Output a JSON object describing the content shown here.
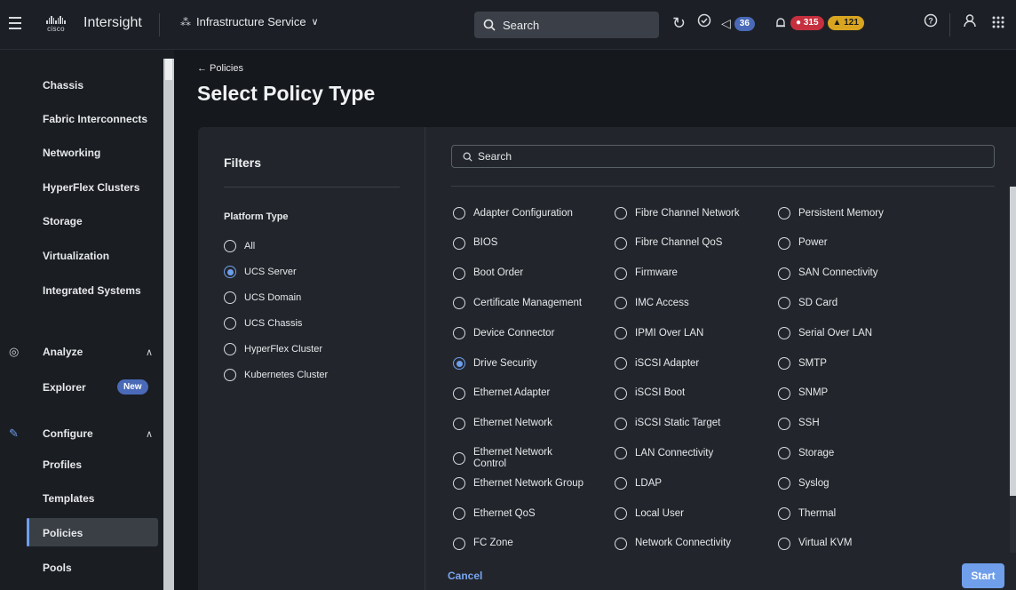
{
  "topbar": {
    "brand_word": "cisco",
    "app_name": "Intersight",
    "service": "Infrastructure Service",
    "search_placeholder": "Search",
    "announcements_count": "36",
    "alarms_critical": "315",
    "alarms_warning": "121"
  },
  "sidebar": {
    "items_top": [
      "Chassis",
      "Fabric Interconnects",
      "Networking",
      "HyperFlex Clusters",
      "Storage",
      "Virtualization",
      "Integrated Systems"
    ],
    "analyze": {
      "label": "Analyze",
      "items": [
        "Explorer"
      ],
      "explorer_badge": "New"
    },
    "configure": {
      "label": "Configure",
      "items": [
        "Profiles",
        "Templates",
        "Policies",
        "Pools"
      ]
    },
    "active_item": "Policies"
  },
  "main": {
    "breadcrumb": "← Policies",
    "title": "Select Policy Type",
    "filters": {
      "title": "Filters",
      "platform_type_label": "Platform Type",
      "options": [
        "All",
        "UCS Server",
        "UCS Domain",
        "UCS Chassis",
        "HyperFlex Cluster",
        "Kubernetes Cluster"
      ],
      "selected": "UCS Server"
    },
    "search_placeholder": "Search",
    "policies_col1": [
      "Adapter Configuration",
      "BIOS",
      "Boot Order",
      "Certificate Management",
      "Device Connector",
      "Drive Security",
      "Ethernet Adapter",
      "Ethernet Network",
      "Ethernet Network Control",
      "Ethernet Network Group",
      "Ethernet QoS",
      "FC Zone"
    ],
    "policies_col2": [
      "Fibre Channel Network",
      "Fibre Channel QoS",
      "Firmware",
      "IMC Access",
      "IPMI Over LAN",
      "iSCSI Adapter",
      "iSCSI Boot",
      "iSCSI Static Target",
      "LAN Connectivity",
      "LDAP",
      "Local User",
      "Network Connectivity"
    ],
    "policies_col3": [
      "Persistent Memory",
      "Power",
      "SAN Connectivity",
      "SD Card",
      "Serial Over LAN",
      "SMTP",
      "SNMP",
      "SSH",
      "Storage",
      "Syslog",
      "Thermal",
      "Virtual KVM"
    ],
    "selected_policy": "Drive Security",
    "cancel_label": "Cancel",
    "start_label": "Start"
  },
  "colors": {
    "accent": "#6f9eea",
    "critical": "#c6303e",
    "warning": "#d9a520",
    "info_badge": "#4a6ab8"
  }
}
